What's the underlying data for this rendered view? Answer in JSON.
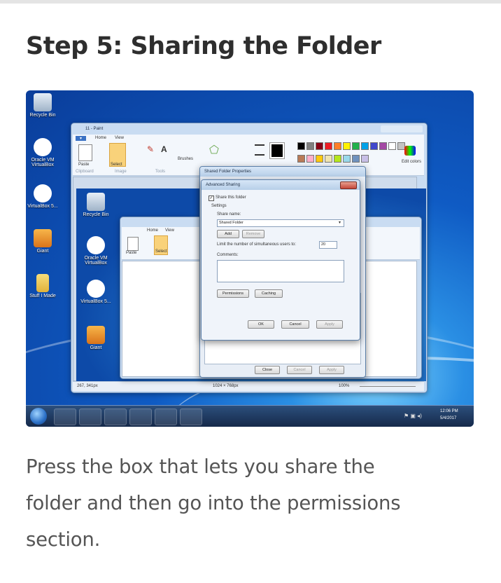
{
  "article": {
    "title": "Step 5: Sharing the Folder",
    "body_line_1": "Press the box that lets you share the",
    "body_line_2": "folder and then go into the permissions",
    "body_line_3": "section."
  },
  "screenshot": {
    "desktop_icons": [
      {
        "label": "Recycle Bin",
        "icon": "recycle-bin-icon"
      },
      {
        "label": "Oracle VM VirtualBox",
        "icon": "virtualbox-icon"
      },
      {
        "label": "VirtualBox 5...",
        "icon": "virtualbox-icon"
      },
      {
        "label": "Giant",
        "icon": "package-icon"
      },
      {
        "label": "Stuff I Made",
        "icon": "folder-icon"
      }
    ],
    "nested_desktop_icons": [
      {
        "label": "Recycle Bin"
      },
      {
        "label": "Oracle VM VirtualBox"
      },
      {
        "label": "VirtualBox 5..."
      },
      {
        "label": "Giant"
      }
    ],
    "paint": {
      "title": "11 - Paint",
      "tabs": [
        "Home",
        "View"
      ],
      "tools": [
        "Paste",
        "Select",
        "Brushes"
      ],
      "groups": [
        "Clipboard",
        "Image",
        "Tools"
      ],
      "edit_colors": "Edit colors",
      "status_pos": "267, 341px",
      "status_size": "1024 × 768px",
      "zoom": "100%"
    },
    "properties_dialog": {
      "title": "Shared Folder Properties",
      "close_label": "Close",
      "cancel_label": "Cancel",
      "apply_label": "Apply"
    },
    "advanced_sharing": {
      "title": "Advanced Sharing",
      "share_checkbox": "Share this folder",
      "share_checked": true,
      "settings_label": "Settings",
      "share_name_label": "Share name:",
      "share_name_value": "Shared Folder",
      "add_label": "Add",
      "remove_label": "Remove",
      "limit_label": "Limit the number of simultaneous users to:",
      "limit_value": "20",
      "comments_label": "Comments:",
      "permissions_label": "Permissions",
      "caching_label": "Caching",
      "ok_label": "OK",
      "cancel_label": "Cancel",
      "apply_label": "Apply"
    },
    "taskbar": {
      "time": "12:06 PM",
      "date": "5/4/2017"
    },
    "palette_colors": [
      "#000000",
      "#7f7f7f",
      "#880015",
      "#ed1c24",
      "#ff7f27",
      "#fff200",
      "#22b14c",
      "#00a2e8",
      "#3f48cc",
      "#a349a4",
      "#ffffff",
      "#c3c3c3",
      "#b97a57",
      "#ffaec9",
      "#ffc90e",
      "#efe4b0",
      "#b5e61d",
      "#99d9ea",
      "#7092be",
      "#c8bfe7"
    ]
  }
}
